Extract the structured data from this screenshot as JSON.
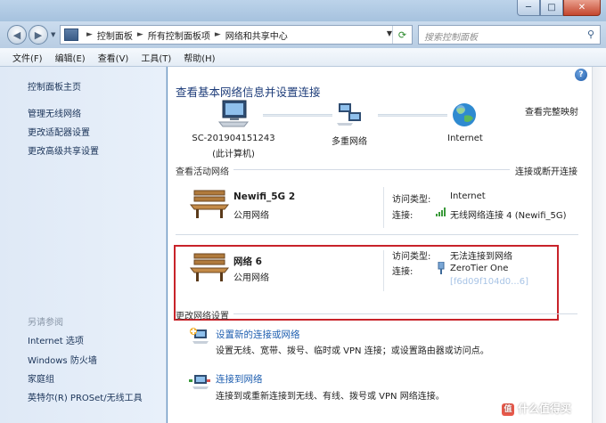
{
  "window": {
    "minimize": "─",
    "maximize": "□",
    "close": "✕"
  },
  "address": {
    "crumbs": [
      "控制面板",
      "所有控制面板项",
      "网络和共享中心"
    ],
    "search_placeholder": "搜索控制面板"
  },
  "menu": [
    "文件(F)",
    "编辑(E)",
    "查看(V)",
    "工具(T)",
    "帮助(H)"
  ],
  "sidebar": {
    "items": [
      "控制面板主页",
      "管理无线网络",
      "更改适配器设置",
      "更改高级共享设置"
    ],
    "see_also_heading": "另请参阅",
    "see_also": [
      "Internet 选项",
      "Windows 防火墙",
      "家庭组",
      "英特尔(R) PROSet/无线工具"
    ]
  },
  "main": {
    "title": "查看基本网络信息并设置连接",
    "full_map_link": "查看完整映射",
    "map": {
      "computer_name": "SC-201904151243",
      "computer_sub": "(此计算机)",
      "middle": "多重网络",
      "right": "Internet"
    },
    "active_heading": "查看活动网络",
    "connect_link": "连接或断开连接",
    "networks": [
      {
        "name": "Newifi_5G  2",
        "type": "公用网络",
        "access_label": "访问类型:",
        "access_value": "Internet",
        "conn_label": "连接:",
        "conn_value": "无线网络连接 4 (Newifi_5G)"
      },
      {
        "name": "网络  6",
        "type": "公用网络",
        "access_label": "访问类型:",
        "access_value": "无法连接到网络",
        "conn_label": "连接:",
        "conn_value": "ZeroTier One",
        "conn_value2": "[f6d09f104d0...6]"
      }
    ],
    "change_heading": "更改网络设置",
    "tasks": [
      {
        "title": "设置新的连接或网络",
        "desc": "设置无线、宽带、拨号、临时或 VPN 连接；或设置路由器或访问点。"
      },
      {
        "title": "连接到网络",
        "desc": "连接到或重新连接到无线、有线、拨号或 VPN 网络连接。"
      }
    ]
  },
  "watermark": {
    "badge": "值",
    "text": "什么值得买"
  },
  "colors": {
    "highlight_border": "#c8232a",
    "link": "#1f5fb0"
  }
}
